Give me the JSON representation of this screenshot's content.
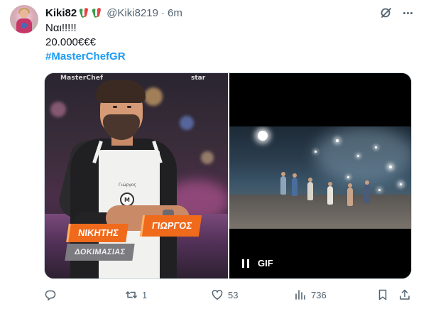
{
  "author": {
    "display_name": "Kiki82",
    "handle": "@Kiki8219",
    "separator": "·",
    "time": "6m"
  },
  "tweet": {
    "line1": "Ναι!!!!!",
    "line2": "20.000€€€",
    "hashtag": "#MasterChefGR"
  },
  "media": {
    "photo": {
      "channel_logo": "MasterChef",
      "station_logo": "star",
      "apron_name": "Γιώργος",
      "apron_logo_text": "M",
      "lower_third_first": "ΝΙΚΗΤΗΣ",
      "lower_third_last": "ΓΙΩΡΓΟΣ",
      "lower_third_sub": "ΔΟΚΙΜΑΣΙΑΣ"
    },
    "gif": {
      "label": "GIF",
      "control_icon": "pause-icon"
    }
  },
  "actions": {
    "reply": {
      "icon": "reply-icon",
      "count": ""
    },
    "repost": {
      "icon": "repost-icon",
      "count": "1"
    },
    "like": {
      "icon": "heart-icon",
      "count": "53"
    },
    "views": {
      "icon": "views-icon",
      "count": "736"
    },
    "bookmark": {
      "icon": "bookmark-icon"
    },
    "share": {
      "icon": "share-icon"
    }
  },
  "colors": {
    "accent": "#1d9bf0",
    "text_primary": "#0f1419",
    "text_secondary": "#536471",
    "lower_third": "#f06a1c"
  }
}
